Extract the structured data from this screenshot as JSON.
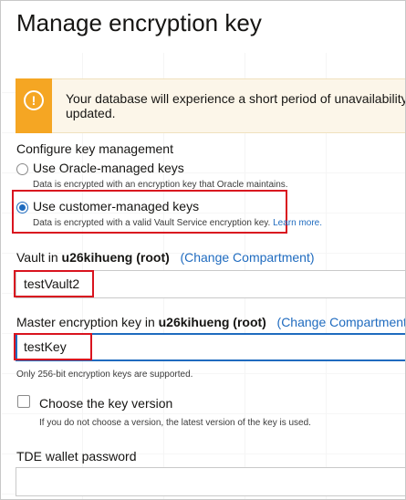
{
  "header": {
    "title": "Manage encryption key"
  },
  "alert": {
    "icon": "exclamation-icon",
    "text_line1": "Your database will experience a short period of unavailability w",
    "text_line2": "updated.",
    "accent_color": "#f5a623"
  },
  "key_management": {
    "section_label": "Configure key management",
    "options": [
      {
        "label": "Use Oracle-managed keys",
        "description": "Data is encrypted with an encryption key that Oracle maintains.",
        "checked": false
      },
      {
        "label": "Use customer-managed keys",
        "description": "Data is encrypted with a valid Vault Service encryption key.",
        "link": "Learn more.",
        "checked": true
      }
    ]
  },
  "vault": {
    "label_prefix": "Vault in ",
    "compartment": "u26kihueng (root)",
    "change_link": "(Change Compartment)",
    "value": "testVault2"
  },
  "master_key": {
    "label_prefix": "Master encryption key in ",
    "compartment": "u26kihueng (root)",
    "change_link": "(Change Compartment)",
    "value": "testKey",
    "help": "Only 256-bit encryption keys are supported."
  },
  "key_version": {
    "label": "Choose the key version",
    "help": "If you do not choose a version, the latest version of the key is used.",
    "checked": false
  },
  "tde_wallet": {
    "label": "TDE wallet password",
    "value": ""
  },
  "colors": {
    "link": "#1f6bbf",
    "highlight_box": "#d9141f",
    "alert_accent": "#f5a623"
  }
}
